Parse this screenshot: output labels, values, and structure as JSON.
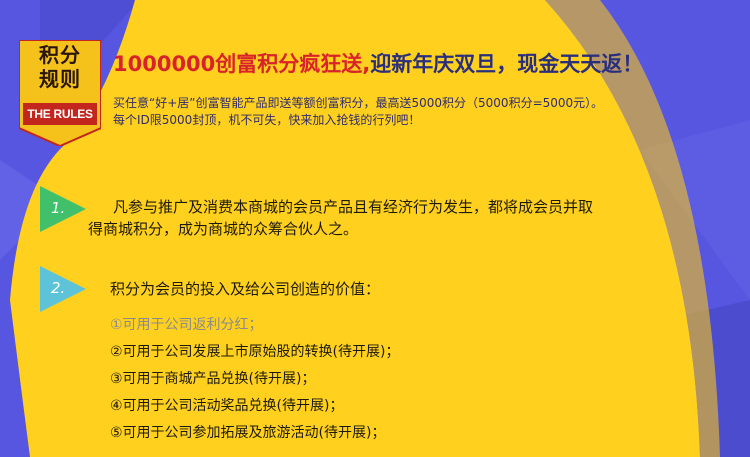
{
  "badge": {
    "line1": "积分",
    "line2": "规则",
    "en": "THE RULES"
  },
  "headline": {
    "red": "1000000创富积分疯狂送,",
    "blue": "迎新年庆双旦，现金天天返！"
  },
  "intro": {
    "line1": "买任意“好+居”创富智能产品即送等额创富积分，最高送5000积分（5000积分=5000元）。",
    "line2": "每个ID限5000封顶，机不可失，快来加入抢钱的行列吧！"
  },
  "items": [
    {
      "number": "1.",
      "line1": "凡参与推广及消费本商城的会员产品且有经济行为发生，都将成会员并取",
      "line2": "得商城积分，成为商城的众筹合伙人之。"
    },
    {
      "number": "2.",
      "line1": "积分为会员的投入及给公司创造的价值："
    }
  ],
  "subitems": [
    "①可用于公司返利分红；",
    "②可用于公司发展上市原始股的转换(待开展)；",
    "③可用于商城产品兑换(待开展)；",
    "④可用于公司活动奖品兑换(待开展)；",
    "⑤可用于公司参加拓展及旅游活动(待开展)；"
  ],
  "colors": {
    "background_blue": "#5656e0",
    "background_yellow": "#ffd11e",
    "badge_gold": "#f5c21c",
    "badge_red": "#c2261d",
    "arrow_green": "#41c06b",
    "arrow_teal": "#5cc3d8",
    "headline_red": "#d9232a",
    "headline_blue": "#2a2f7d"
  }
}
